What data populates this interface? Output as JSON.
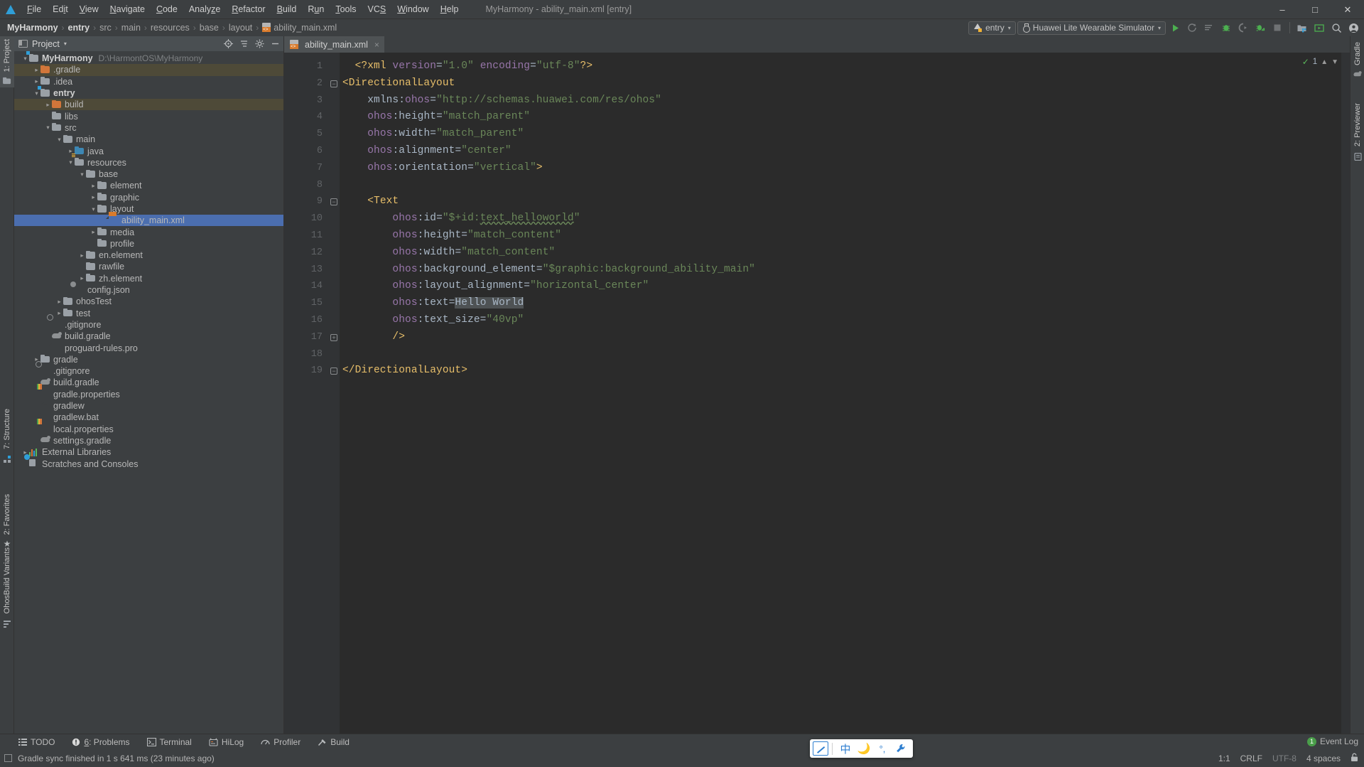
{
  "window": {
    "title": "MyHarmony - ability_main.xml [entry]",
    "logo": "harmonyos-logo-icon",
    "controls": [
      "minimize-icon",
      "maximize-icon",
      "close-icon"
    ]
  },
  "menubar": {
    "items": [
      "File",
      "Edit",
      "View",
      "Navigate",
      "Code",
      "Analyze",
      "Refactor",
      "Build",
      "Run",
      "Tools",
      "VCS",
      "Window",
      "Help"
    ]
  },
  "breadcrumb": {
    "items": [
      {
        "label": "MyHarmony",
        "bold": true,
        "icon": ""
      },
      {
        "label": "entry",
        "bold": true,
        "icon": ""
      },
      {
        "label": "src",
        "bold": false,
        "icon": ""
      },
      {
        "label": "main",
        "bold": false,
        "icon": ""
      },
      {
        "label": "resources",
        "bold": false,
        "icon": ""
      },
      {
        "label": "base",
        "bold": false,
        "icon": ""
      },
      {
        "label": "layout",
        "bold": false,
        "icon": ""
      },
      {
        "label": "ability_main.xml",
        "bold": false,
        "icon": "xml-file-icon"
      }
    ],
    "separator": "›"
  },
  "toolbar": {
    "module_config": "entry",
    "device_target": "Huawei Lite Wearable Simulator",
    "caret": "▾",
    "icons": [
      "run-icon",
      "rerun-icon",
      "run-with-coverage-icon",
      "debug-icon",
      "profile-icon",
      "attach-debugger-icon",
      "stop-icon",
      "project-structure-icon",
      "avd-manager-icon",
      "search-everywhere-icon",
      "account-icon"
    ]
  },
  "sidebar_rails": {
    "left": [
      {
        "label": "1: Project",
        "active": true
      },
      {
        "label": "7: Structure",
        "active": false
      },
      {
        "label": "2: Favorites",
        "active": false
      },
      {
        "label": "OhosBuild Variants",
        "active": false
      }
    ],
    "right": [
      {
        "label": "Gradle",
        "active": false
      },
      {
        "label": "2: Previewer",
        "active": false
      }
    ]
  },
  "project_panel": {
    "title": "Project",
    "caret": "▾",
    "actions": [
      "locate-icon",
      "collapse-all-icon",
      "settings-icon",
      "hide-icon"
    ],
    "tree": [
      {
        "depth": 0,
        "arrow": "⌄",
        "icon": "folder-module",
        "name": "MyHarmony",
        "bold": true,
        "path": "D:\\HarmontOS\\MyHarmony",
        "tint": false,
        "selected": false
      },
      {
        "depth": 1,
        "arrow": "›",
        "icon": "folder-orange",
        "name": ".gradle",
        "bold": false,
        "path": "",
        "tint": true,
        "selected": false
      },
      {
        "depth": 1,
        "arrow": "›",
        "icon": "folder",
        "name": ".idea",
        "bold": false,
        "path": "",
        "tint": false,
        "selected": false
      },
      {
        "depth": 1,
        "arrow": "⌄",
        "icon": "folder-module",
        "name": "entry",
        "bold": true,
        "path": "",
        "tint": false,
        "selected": false
      },
      {
        "depth": 2,
        "arrow": "›",
        "icon": "folder-orange",
        "name": "build",
        "bold": false,
        "path": "",
        "tint": true,
        "selected": false
      },
      {
        "depth": 2,
        "arrow": "",
        "icon": "folder",
        "name": "libs",
        "bold": false,
        "path": "",
        "tint": false,
        "selected": false
      },
      {
        "depth": 2,
        "arrow": "⌄",
        "icon": "folder",
        "name": "src",
        "bold": false,
        "path": "",
        "tint": false,
        "selected": false
      },
      {
        "depth": 3,
        "arrow": "⌄",
        "icon": "folder",
        "name": "main",
        "bold": false,
        "path": "",
        "tint": false,
        "selected": false
      },
      {
        "depth": 4,
        "arrow": "›",
        "icon": "folder-blue",
        "name": "java",
        "bold": false,
        "path": "",
        "tint": false,
        "selected": false
      },
      {
        "depth": 4,
        "arrow": "⌄",
        "icon": "folder-resources",
        "name": "resources",
        "bold": false,
        "path": "",
        "tint": false,
        "selected": false
      },
      {
        "depth": 5,
        "arrow": "⌄",
        "icon": "folder",
        "name": "base",
        "bold": false,
        "path": "",
        "tint": false,
        "selected": false
      },
      {
        "depth": 6,
        "arrow": "›",
        "icon": "folder",
        "name": "element",
        "bold": false,
        "path": "",
        "tint": false,
        "selected": false
      },
      {
        "depth": 6,
        "arrow": "›",
        "icon": "folder",
        "name": "graphic",
        "bold": false,
        "path": "",
        "tint": false,
        "selected": false
      },
      {
        "depth": 6,
        "arrow": "⌄",
        "icon": "folder",
        "name": "layout",
        "bold": false,
        "path": "",
        "tint": false,
        "selected": false
      },
      {
        "depth": 7,
        "arrow": "",
        "icon": "xml-file",
        "name": "ability_main.xml",
        "bold": false,
        "path": "",
        "tint": false,
        "selected": true
      },
      {
        "depth": 6,
        "arrow": "›",
        "icon": "folder",
        "name": "media",
        "bold": false,
        "path": "",
        "tint": false,
        "selected": false
      },
      {
        "depth": 6,
        "arrow": "",
        "icon": "folder",
        "name": "profile",
        "bold": false,
        "path": "",
        "tint": false,
        "selected": false
      },
      {
        "depth": 5,
        "arrow": "›",
        "icon": "folder",
        "name": "en.element",
        "bold": false,
        "path": "",
        "tint": false,
        "selected": false
      },
      {
        "depth": 5,
        "arrow": "",
        "icon": "folder",
        "name": "rawfile",
        "bold": false,
        "path": "",
        "tint": false,
        "selected": false
      },
      {
        "depth": 5,
        "arrow": "›",
        "icon": "folder",
        "name": "zh.element",
        "bold": false,
        "path": "",
        "tint": false,
        "selected": false
      },
      {
        "depth": 4,
        "arrow": "",
        "icon": "json-file",
        "name": "config.json",
        "bold": false,
        "path": "",
        "tint": false,
        "selected": false
      },
      {
        "depth": 3,
        "arrow": "›",
        "icon": "folder",
        "name": "ohosTest",
        "bold": false,
        "path": "",
        "tint": false,
        "selected": false
      },
      {
        "depth": 3,
        "arrow": "›",
        "icon": "folder",
        "name": "test",
        "bold": false,
        "path": "",
        "tint": false,
        "selected": false
      },
      {
        "depth": 2,
        "arrow": "",
        "icon": "gitignore-file",
        "name": ".gitignore",
        "bold": false,
        "path": "",
        "tint": false,
        "selected": false
      },
      {
        "depth": 2,
        "arrow": "",
        "icon": "gradle-file",
        "name": "build.gradle",
        "bold": false,
        "path": "",
        "tint": false,
        "selected": false
      },
      {
        "depth": 2,
        "arrow": "",
        "icon": "text-file",
        "name": "proguard-rules.pro",
        "bold": false,
        "path": "",
        "tint": false,
        "selected": false
      },
      {
        "depth": 1,
        "arrow": "›",
        "icon": "folder",
        "name": "gradle",
        "bold": false,
        "path": "",
        "tint": false,
        "selected": false
      },
      {
        "depth": 1,
        "arrow": "",
        "icon": "gitignore-file",
        "name": ".gitignore",
        "bold": false,
        "path": "",
        "tint": false,
        "selected": false
      },
      {
        "depth": 1,
        "arrow": "",
        "icon": "gradle-file",
        "name": "build.gradle",
        "bold": false,
        "path": "",
        "tint": false,
        "selected": false
      },
      {
        "depth": 1,
        "arrow": "",
        "icon": "properties-file",
        "name": "gradle.properties",
        "bold": false,
        "path": "",
        "tint": false,
        "selected": false
      },
      {
        "depth": 1,
        "arrow": "",
        "icon": "script-file",
        "name": "gradlew",
        "bold": false,
        "path": "",
        "tint": false,
        "selected": false
      },
      {
        "depth": 1,
        "arrow": "",
        "icon": "text-file",
        "name": "gradlew.bat",
        "bold": false,
        "path": "",
        "tint": false,
        "selected": false
      },
      {
        "depth": 1,
        "arrow": "",
        "icon": "properties-file",
        "name": "local.properties",
        "bold": false,
        "path": "",
        "tint": false,
        "selected": false
      },
      {
        "depth": 1,
        "arrow": "",
        "icon": "gradle-file",
        "name": "settings.gradle",
        "bold": false,
        "path": "",
        "tint": false,
        "selected": false
      },
      {
        "depth": 0,
        "arrow": "›",
        "icon": "libraries",
        "name": "External Libraries",
        "bold": false,
        "path": "",
        "tint": false,
        "selected": false
      },
      {
        "depth": 0,
        "arrow": "",
        "icon": "scratches",
        "name": "Scratches and Consoles",
        "bold": false,
        "path": "",
        "tint": false,
        "selected": false
      }
    ]
  },
  "editor": {
    "tab": {
      "label": "ability_main.xml",
      "close": "×",
      "icon": "xml-file-icon"
    },
    "inspection_count": "1",
    "lines": [
      {
        "n": "1",
        "fold": "",
        "tokens": [
          {
            "t": "  ",
            "c": "plain"
          },
          {
            "t": "<?xml ",
            "c": "pi"
          },
          {
            "t": "version",
            "c": "attr"
          },
          {
            "t": "=",
            "c": "eq"
          },
          {
            "t": "\"1.0\"",
            "c": "val"
          },
          {
            "t": " ",
            "c": "plain"
          },
          {
            "t": "encoding",
            "c": "attr"
          },
          {
            "t": "=",
            "c": "eq"
          },
          {
            "t": "\"utf-8\"",
            "c": "val"
          },
          {
            "t": "?>",
            "c": "pi"
          }
        ]
      },
      {
        "n": "2",
        "fold": "minus",
        "tokens": [
          {
            "t": "<DirectionalLayout",
            "c": "tag"
          }
        ]
      },
      {
        "n": "3",
        "fold": "",
        "tokens": [
          {
            "t": "    ",
            "c": "plain"
          },
          {
            "t": "xmlns:",
            "c": "plain"
          },
          {
            "t": "ohos",
            "c": "attr"
          },
          {
            "t": "=",
            "c": "eq"
          },
          {
            "t": "\"http://schemas.huawei.com/res/ohos\"",
            "c": "val"
          }
        ]
      },
      {
        "n": "4",
        "fold": "",
        "tokens": [
          {
            "t": "    ",
            "c": "plain"
          },
          {
            "t": "ohos",
            "c": "attr"
          },
          {
            "t": ":",
            "c": "plain"
          },
          {
            "t": "height",
            "c": "plain"
          },
          {
            "t": "=",
            "c": "eq"
          },
          {
            "t": "\"match_parent\"",
            "c": "val"
          }
        ]
      },
      {
        "n": "5",
        "fold": "",
        "tokens": [
          {
            "t": "    ",
            "c": "plain"
          },
          {
            "t": "ohos",
            "c": "attr"
          },
          {
            "t": ":",
            "c": "plain"
          },
          {
            "t": "width",
            "c": "plain"
          },
          {
            "t": "=",
            "c": "eq"
          },
          {
            "t": "\"match_parent\"",
            "c": "val"
          }
        ]
      },
      {
        "n": "6",
        "fold": "",
        "tokens": [
          {
            "t": "    ",
            "c": "plain"
          },
          {
            "t": "ohos",
            "c": "attr"
          },
          {
            "t": ":",
            "c": "plain"
          },
          {
            "t": "alignment",
            "c": "plain"
          },
          {
            "t": "=",
            "c": "eq"
          },
          {
            "t": "\"center\"",
            "c": "val"
          }
        ]
      },
      {
        "n": "7",
        "fold": "",
        "tokens": [
          {
            "t": "    ",
            "c": "plain"
          },
          {
            "t": "ohos",
            "c": "attr"
          },
          {
            "t": ":",
            "c": "plain"
          },
          {
            "t": "orientation",
            "c": "plain"
          },
          {
            "t": "=",
            "c": "eq"
          },
          {
            "t": "\"vertical\"",
            "c": "val"
          },
          {
            "t": ">",
            "c": "tag"
          }
        ]
      },
      {
        "n": "8",
        "fold": "",
        "tokens": []
      },
      {
        "n": "9",
        "fold": "minus",
        "tokens": [
          {
            "t": "    ",
            "c": "plain"
          },
          {
            "t": "<Text",
            "c": "tag"
          }
        ]
      },
      {
        "n": "10",
        "fold": "",
        "tokens": [
          {
            "t": "        ",
            "c": "plain"
          },
          {
            "t": "ohos",
            "c": "attr"
          },
          {
            "t": ":",
            "c": "plain"
          },
          {
            "t": "id",
            "c": "plain"
          },
          {
            "t": "=",
            "c": "eq"
          },
          {
            "t": "\"$+id:",
            "c": "val"
          },
          {
            "t": "text_helloworld",
            "c": "val-squig"
          },
          {
            "t": "\"",
            "c": "val"
          }
        ]
      },
      {
        "n": "11",
        "fold": "",
        "tokens": [
          {
            "t": "        ",
            "c": "plain"
          },
          {
            "t": "ohos",
            "c": "attr"
          },
          {
            "t": ":",
            "c": "plain"
          },
          {
            "t": "height",
            "c": "plain"
          },
          {
            "t": "=",
            "c": "eq"
          },
          {
            "t": "\"match_content\"",
            "c": "val"
          }
        ]
      },
      {
        "n": "12",
        "fold": "",
        "tokens": [
          {
            "t": "        ",
            "c": "plain"
          },
          {
            "t": "ohos",
            "c": "attr"
          },
          {
            "t": ":",
            "c": "plain"
          },
          {
            "t": "width",
            "c": "plain"
          },
          {
            "t": "=",
            "c": "eq"
          },
          {
            "t": "\"match_content\"",
            "c": "val"
          }
        ]
      },
      {
        "n": "13",
        "fold": "",
        "tokens": [
          {
            "t": "        ",
            "c": "plain"
          },
          {
            "t": "ohos",
            "c": "attr"
          },
          {
            "t": ":",
            "c": "plain"
          },
          {
            "t": "background_element",
            "c": "plain"
          },
          {
            "t": "=",
            "c": "eq"
          },
          {
            "t": "\"$graphic:background_ability_main\"",
            "c": "val"
          }
        ]
      },
      {
        "n": "14",
        "fold": "",
        "tokens": [
          {
            "t": "        ",
            "c": "plain"
          },
          {
            "t": "ohos",
            "c": "attr"
          },
          {
            "t": ":",
            "c": "plain"
          },
          {
            "t": "layout_alignment",
            "c": "plain"
          },
          {
            "t": "=",
            "c": "eq"
          },
          {
            "t": "\"horizontal_center\"",
            "c": "val"
          }
        ]
      },
      {
        "n": "15",
        "fold": "",
        "tokens": [
          {
            "t": "        ",
            "c": "plain"
          },
          {
            "t": "ohos",
            "c": "attr"
          },
          {
            "t": ":",
            "c": "plain"
          },
          {
            "t": "text",
            "c": "plain"
          },
          {
            "t": "=",
            "c": "eq"
          },
          {
            "t": "Hello World",
            "c": "sel"
          }
        ]
      },
      {
        "n": "16",
        "fold": "",
        "tokens": [
          {
            "t": "        ",
            "c": "plain"
          },
          {
            "t": "ohos",
            "c": "attr"
          },
          {
            "t": ":",
            "c": "plain"
          },
          {
            "t": "text_size",
            "c": "plain"
          },
          {
            "t": "=",
            "c": "eq"
          },
          {
            "t": "\"40vp\"",
            "c": "val"
          }
        ]
      },
      {
        "n": "17",
        "fold": "plus",
        "tokens": [
          {
            "t": "        ",
            "c": "plain"
          },
          {
            "t": "/>",
            "c": "tag"
          }
        ]
      },
      {
        "n": "18",
        "fold": "",
        "tokens": []
      },
      {
        "n": "19",
        "fold": "minus",
        "tokens": [
          {
            "t": "</DirectionalLayout>",
            "c": "tag"
          }
        ]
      }
    ]
  },
  "bottom": {
    "tools": [
      {
        "label": "TODO",
        "icon": "todo-icon",
        "badge": ""
      },
      {
        "label": "6: Problems",
        "icon": "problems-icon",
        "badge": "6"
      },
      {
        "label": "Terminal",
        "icon": "terminal-icon",
        "badge": ""
      },
      {
        "label": "HiLog",
        "icon": "hilog-icon",
        "badge": ""
      },
      {
        "label": "Profiler",
        "icon": "profiler-icon",
        "badge": ""
      },
      {
        "label": "Build",
        "icon": "build-icon",
        "badge": ""
      }
    ],
    "status_message": "Gradle sync finished in 1 s 641 ms (23 minutes ago)",
    "event_log": {
      "label": "Event Log",
      "count": "1"
    },
    "caret_position": "1:1",
    "line_separator": "CRLF",
    "encoding": "UTF-8",
    "indent": "4 spaces",
    "lock_icon": "unlocked-icon"
  },
  "ime": {
    "icons": [
      "ime-mode-icon",
      "chinese-mode-icon",
      "moon-icon",
      "punctuation-icon",
      "wrench-icon"
    ],
    "chinese_label": "中"
  },
  "colors": {
    "accent": "#4b6eaf",
    "background": "#3c3f41",
    "editor_bg": "#2b2b2b",
    "tag": "#e8bf6a",
    "attr": "#9876aa",
    "value": "#6a8759",
    "plain": "#a9b7c6"
  }
}
